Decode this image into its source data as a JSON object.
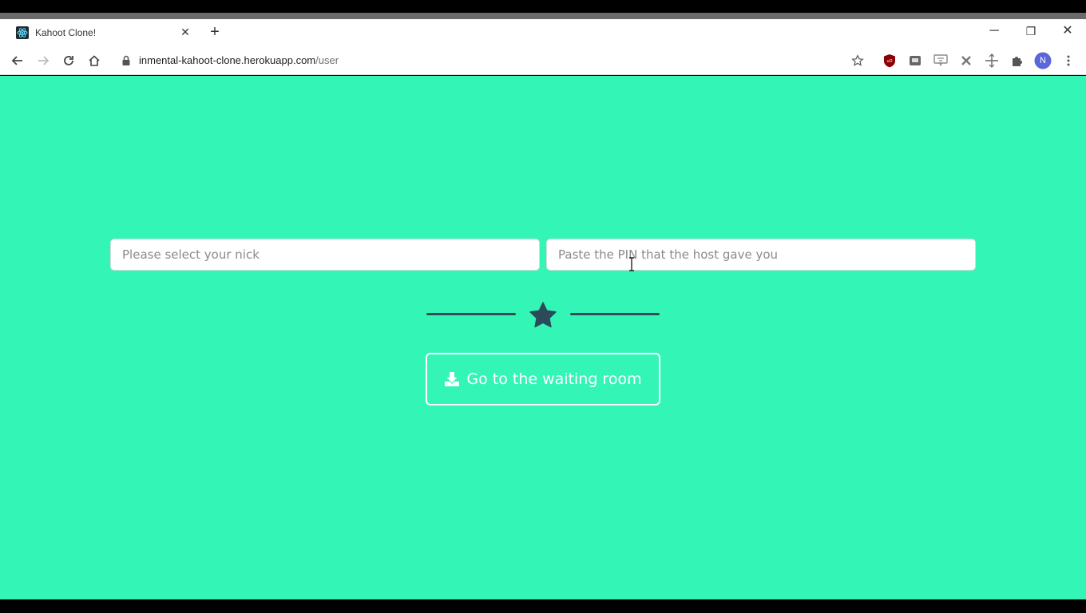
{
  "browser": {
    "tab": {
      "title": "Kahoot Clone!",
      "close_glyph": "✕",
      "favicon": "react-logo-icon"
    },
    "new_tab_glyph": "+",
    "window_controls": {
      "minimize": "─",
      "restore": "❐",
      "close": "✕"
    },
    "address": {
      "host": "inmental-kahoot-clone.herokuapp.com",
      "path": "/user"
    },
    "profile_initial": "N",
    "icons": [
      "back-icon",
      "forward-icon",
      "reload-icon",
      "home-icon",
      "lock-icon",
      "bookmark-star-icon",
      "ublock-icon",
      "extension-icon",
      "extension-icon",
      "extension-icon",
      "extension-icon",
      "puzzle-icon",
      "profile-avatar",
      "kebab-menu-icon"
    ]
  },
  "page": {
    "background": "#33f5b5",
    "accent": "#2d4a5a",
    "nick_input": {
      "placeholder": "Please select your nick",
      "value": ""
    },
    "pin_input": {
      "placeholder": "Paste the PIN that the host gave you",
      "value": ""
    },
    "divider_icon": "star-icon",
    "go_button": {
      "label": "Go to the waiting room",
      "icon": "download-icon"
    }
  }
}
